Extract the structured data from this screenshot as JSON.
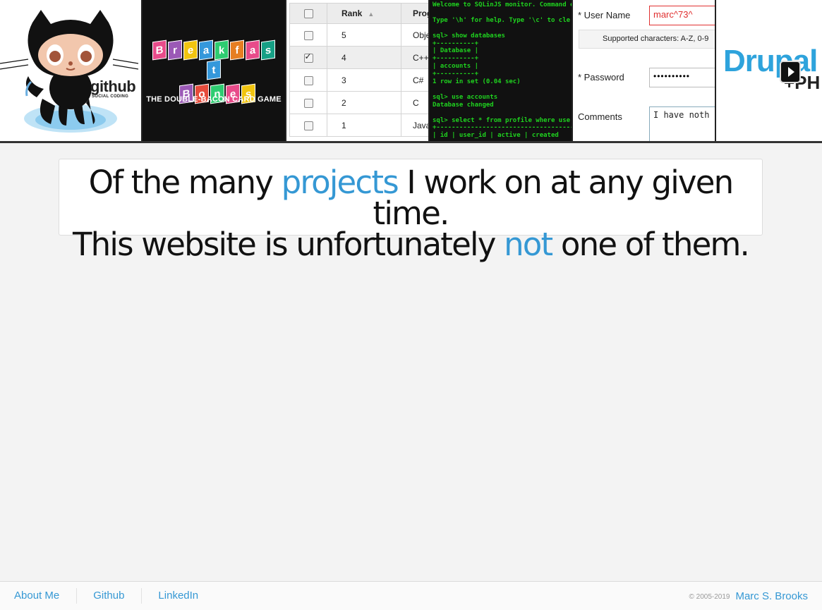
{
  "strip": {
    "github": {
      "word": "github",
      "sub": "SOCIAL CODING",
      "icon": "octocat-icon"
    },
    "breakfast_bones": {
      "letters": [
        "B",
        "r",
        "e",
        "a",
        "k",
        "f",
        "a",
        "s",
        "t",
        "B",
        "o",
        "n",
        "e",
        "s"
      ],
      "letter_colors": [
        "#e84b8a",
        "#9b59b6",
        "#f1c40f",
        "#3498db",
        "#2ecc71",
        "#e67e22",
        "#e84b8a",
        "#16a085",
        "#3498db",
        "#9b59b6",
        "#e74c3c",
        "#2ecc71",
        "#e84b8a",
        "#f1c40f"
      ],
      "subtitle": "THE DOUBLE-BACON CARD GAME"
    },
    "grid": {
      "headers": [
        "Rank",
        "Prog"
      ],
      "rows": [
        {
          "rank": "5",
          "program": "Object",
          "checked": false
        },
        {
          "rank": "4",
          "program": "C++",
          "checked": true
        },
        {
          "rank": "3",
          "program": "C#",
          "checked": false
        },
        {
          "rank": "2",
          "program": "C",
          "checked": false
        },
        {
          "rank": "1",
          "program": "Java",
          "checked": false
        }
      ]
    },
    "terminal": {
      "lines": [
        "Welcome to SQLinJS monitor. Command e",
        "",
        "Type '\\h' for help. Type '\\c' to cle",
        "",
        "sql> show databases",
        "+----------+",
        "| Database |",
        "+----------+",
        "| accounts |",
        "+----------+",
        "1 row in set (0.04 sec)",
        "",
        "sql> use accounts",
        "Database changed",
        "",
        "sql> select * from profile where use",
        "+------------------------------------",
        "| id | user_id | active | created"
      ]
    },
    "form": {
      "username_label": "* User Name",
      "username_value": "marc^73^",
      "hint": "Supported characters: A-Z, 0-9",
      "password_label": "* Password",
      "password_value": "••••••••••",
      "comments_label": "Comments",
      "comments_value": "I have noth"
    },
    "drupal": {
      "word": "Drupal",
      "plus": "+PH",
      "play_icon": "play-icon"
    }
  },
  "banner": {
    "line1_before": "Of the many ",
    "line1_highlight": "projects",
    "line1_after": " I work on at any given time.",
    "line2_before": "This website is unfortunately ",
    "line2_highlight": "not",
    "line2_after": " one of them."
  },
  "footer": {
    "links": [
      "About Me",
      "Github",
      "LinkedIn"
    ],
    "copyright": "© 2005-2019",
    "author": "Marc S. Brooks"
  }
}
